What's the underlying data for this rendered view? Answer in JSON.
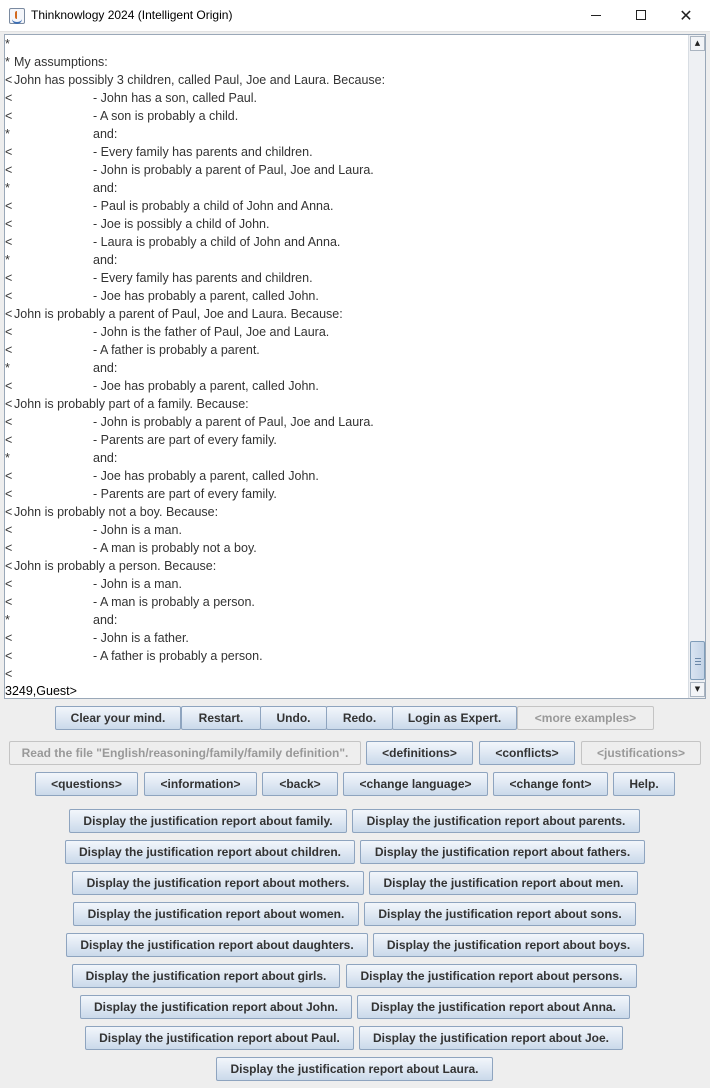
{
  "window": {
    "title": "Thinknowlogy 2024 (Intelligent Origin)",
    "minimize_label": "minimize",
    "maximize_label": "maximize",
    "close_label": "close"
  },
  "output": {
    "lines": [
      {
        "marker": "*",
        "text": ""
      },
      {
        "marker": "*",
        "text": "My assumptions:"
      },
      {
        "marker": "<",
        "text": "John has possibly 3 children, called Paul, Joe and Laura. Because:"
      },
      {
        "marker": "<",
        "text": "- John has a son, called Paul."
      },
      {
        "marker": "<",
        "text": "- A son is probably a child."
      },
      {
        "marker": "*",
        "text": "and:"
      },
      {
        "marker": "<",
        "text": "- Every family has parents and children."
      },
      {
        "marker": "<",
        "text": "- John is probably a parent of Paul, Joe and Laura."
      },
      {
        "marker": "*",
        "text": "and:"
      },
      {
        "marker": "<",
        "text": "- Paul is probably a child of John and Anna."
      },
      {
        "marker": "<",
        "text": "- Joe is possibly a child of John."
      },
      {
        "marker": "<",
        "text": "- Laura is probably a child of John and Anna."
      },
      {
        "marker": "*",
        "text": "and:"
      },
      {
        "marker": "<",
        "text": "- Every family has parents and children."
      },
      {
        "marker": "<",
        "text": "- Joe has probably a parent, called John."
      },
      {
        "marker": "<",
        "text": "John is probably a parent of Paul, Joe and Laura. Because:"
      },
      {
        "marker": "<",
        "text": "- John is the father of Paul, Joe and Laura."
      },
      {
        "marker": "<",
        "text": "- A father is probably a parent."
      },
      {
        "marker": "*",
        "text": "and:"
      },
      {
        "marker": "<",
        "text": "- Joe has probably a parent, called John."
      },
      {
        "marker": "<",
        "text": "John is probably part of a family. Because:"
      },
      {
        "marker": "<",
        "text": "- John is probably a parent of Paul, Joe and Laura."
      },
      {
        "marker": "<",
        "text": "- Parents are part of every family."
      },
      {
        "marker": "*",
        "text": "and:"
      },
      {
        "marker": "<",
        "text": "- Joe has probably a parent, called John."
      },
      {
        "marker": "<",
        "text": "- Parents are part of every family."
      },
      {
        "marker": "<",
        "text": "John is probably not a boy. Because:"
      },
      {
        "marker": "<",
        "text": "- John is a man."
      },
      {
        "marker": "<",
        "text": "- A man is probably not a boy."
      },
      {
        "marker": "<",
        "text": "John is probably a person. Because:"
      },
      {
        "marker": "<",
        "text": "- John is a man."
      },
      {
        "marker": "<",
        "text": "- A man is probably a person."
      },
      {
        "marker": "*",
        "text": "and:"
      },
      {
        "marker": "<",
        "text": "- John is a father."
      },
      {
        "marker": "<",
        "text": "- A father is probably a person."
      },
      {
        "marker": "<",
        "text": ""
      }
    ],
    "prompt": "3249,Guest>"
  },
  "toolbar": {
    "clear_mind": "Clear your mind.",
    "restart": "Restart.",
    "undo": "Undo.",
    "redo": "Redo.",
    "login_expert": "Login as Expert.",
    "more_examples": "<more examples>",
    "read_file": "Read the file \"English/reasoning/family/family definition\".",
    "definitions": "<definitions>",
    "conflicts": "<conflicts>",
    "justifications": "<justifications>",
    "questions": "<questions>",
    "information": "<information>",
    "back": "<back>",
    "change_language": "<change language>",
    "change_font": "<change font>",
    "help": "Help."
  },
  "reports": [
    "Display the justification report about family.",
    "Display the justification report about parents.",
    "Display the justification report about children.",
    "Display the justification report about fathers.",
    "Display the justification report about mothers.",
    "Display the justification report about men.",
    "Display the justification report about women.",
    "Display the justification report about sons.",
    "Display the justification report about daughters.",
    "Display the justification report about boys.",
    "Display the justification report about girls.",
    "Display the justification report about persons.",
    "Display the justification report about John.",
    "Display the justification report about Anna.",
    "Display the justification report about Paul.",
    "Display the justification report about Joe.",
    "Display the justification report about Laura."
  ]
}
